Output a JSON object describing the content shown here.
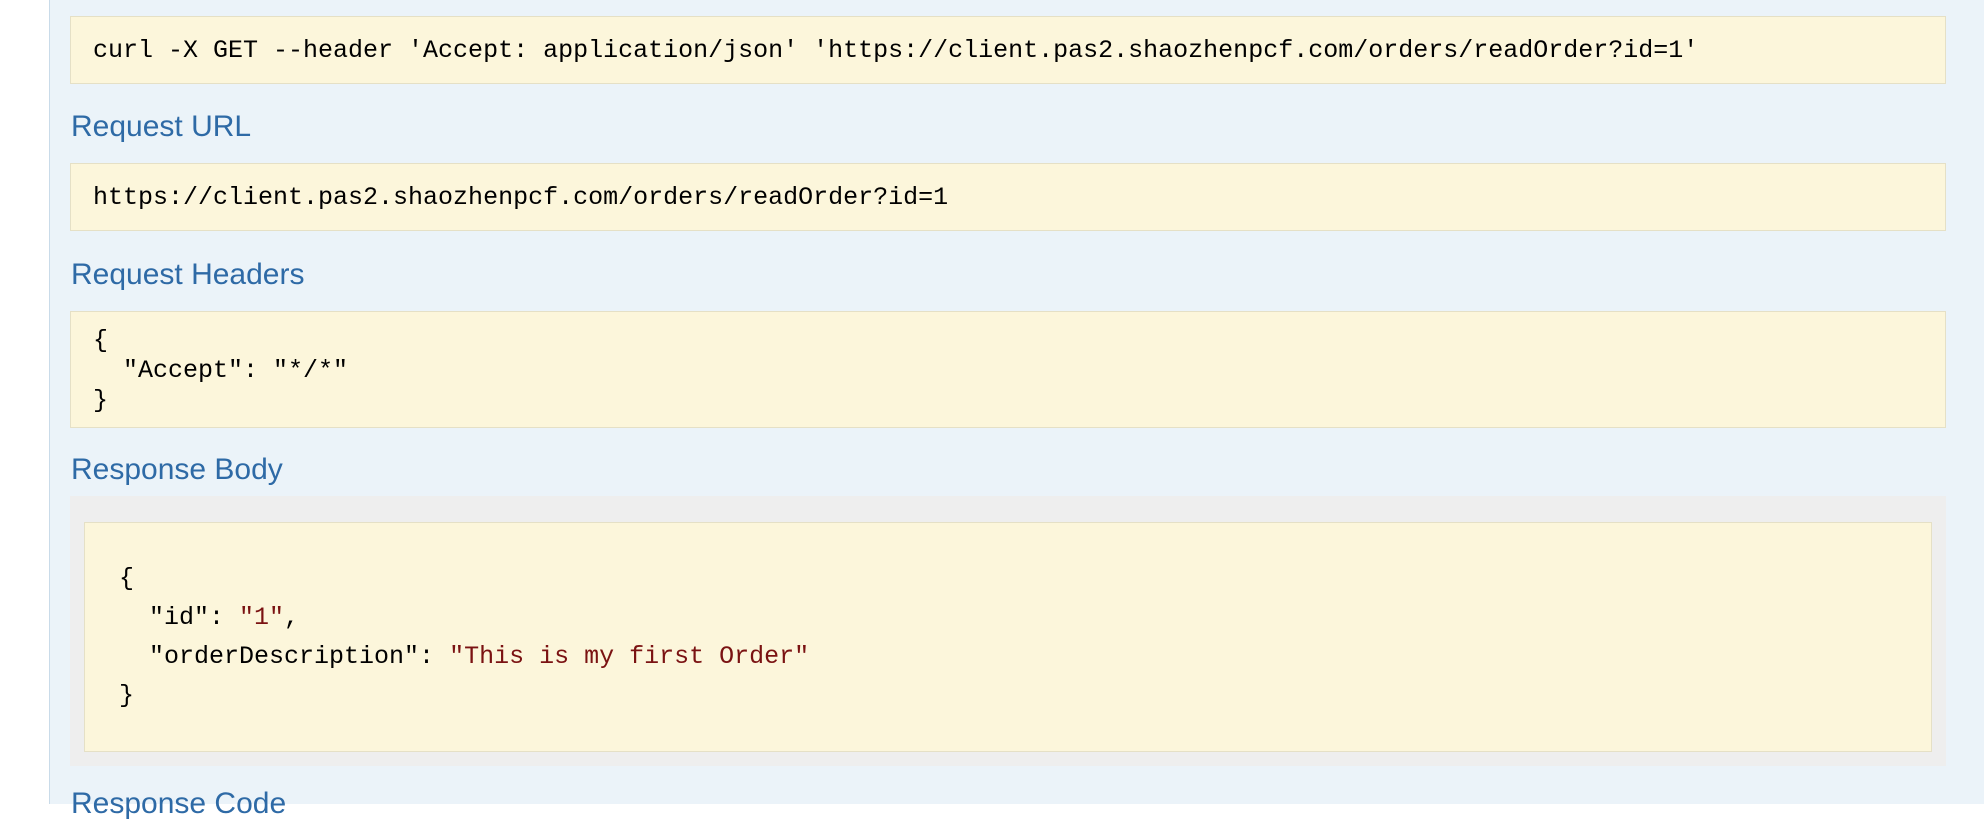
{
  "curl": {
    "command": "curl -X GET --header 'Accept: application/json' 'https://client.pas2.shaozhenpcf.com/orders/readOrder?id=1'"
  },
  "request_url": {
    "heading": "Request URL",
    "value": "https://client.pas2.shaozhenpcf.com/orders/readOrder?id=1"
  },
  "request_headers": {
    "heading": "Request Headers",
    "open_brace": "{",
    "line": "\"Accept\": \"*/*\"",
    "close_brace": "}"
  },
  "response_body": {
    "heading": "Response Body",
    "open_brace": "{",
    "id_key": "\"id\": ",
    "id_value": "\"1\"",
    "id_comma": ",",
    "desc_key": "\"orderDescription\": ",
    "desc_value": "\"This is my first Order\"",
    "close_brace": "}"
  },
  "response_code": {
    "heading": "Response Code"
  },
  "colors": {
    "heading": "#2e6aa6",
    "panel_bg": "#ebf3f9",
    "code_bg": "#fcf6db",
    "string_value": "#7a1212"
  }
}
